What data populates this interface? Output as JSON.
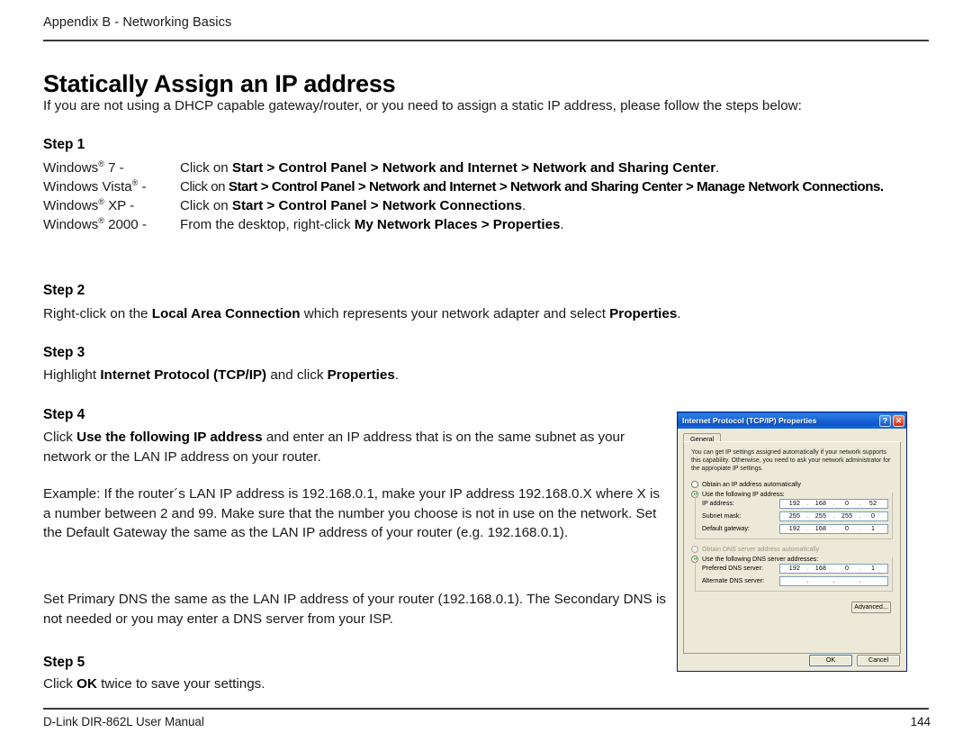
{
  "running_head": "Appendix B - Networking Basics",
  "page_title": "Statically Assign an IP address",
  "intro": "If you are not using a DHCP capable gateway/router, or you need to assign a static IP address, please follow the steps below:",
  "steps": {
    "step1": {
      "label": "Step 1",
      "rows": [
        {
          "os_prefix": "Windows",
          "os_reg": "®",
          "os_suffix": " 7 -",
          "instruction_lead": "Click on ",
          "instruction_bold1": "Start",
          "sep1": " > ",
          "instruction_bold2": "Control Panel",
          "sep2": " > ",
          "instruction_bold3": "Network and Internet",
          "sep3": " > ",
          "instruction_bold4": "Network and Sharing Center",
          "tail": "."
        },
        {
          "os_prefix": "Windows Vista",
          "os_reg": "®",
          "os_suffix": " -",
          "instruction_lead": "Click on ",
          "instruction_bold1": "Start",
          "sep1": " > ",
          "instruction_bold2": "Control Panel",
          "sep2": " > ",
          "instruction_bold3": "Network and Internet",
          "sep3": " > ",
          "instruction_bold4": "Network and Sharing Center",
          "sep4": " > ",
          "instruction_bold5": "Manage Network Connections",
          "tail": "."
        },
        {
          "os_prefix": "Windows",
          "os_reg": "®",
          "os_suffix": " XP -",
          "instruction_lead": "Click on ",
          "instruction_bold1": "Start",
          "sep1": " > ",
          "instruction_bold2": "Control Panel",
          "sep2": " > ",
          "instruction_bold3": "Network Connections",
          "tail": "."
        },
        {
          "os_prefix": "Windows",
          "os_reg": "®",
          "os_suffix": " 2000 -",
          "instruction_lead": "From the desktop, right-click ",
          "instruction_bold1": "My Network Places",
          "sep1": " > ",
          "instruction_bold2": "Properties",
          "tail": "."
        }
      ]
    },
    "step2": {
      "label": "Step 2",
      "text_a": "Right-click on the ",
      "bold_a": "Local Area Connection",
      "text_b": " which represents your network adapter and select ",
      "bold_b": "Properties",
      "text_c": "."
    },
    "step3": {
      "label": "Step 3",
      "text_a": "Highlight ",
      "bold_a": "Internet Protocol (TCP/IP)",
      "text_b": " and click ",
      "bold_b": "Properties",
      "text_c": "."
    },
    "step4": {
      "label": "Step 4",
      "text_a": "Click ",
      "bold_a": "Use the following IP address",
      "text_b": " and enter an IP address that is on the same subnet as your network or the LAN IP address on your router.",
      "example": "Example: If the router´s LAN IP address is 192.168.0.1, make your IP address 192.168.0.X where X is a number between 2 and 99. Make sure that the number you choose is not in use on the network. Set the Default Gateway the same as the LAN IP address of your router (e.g. 192.168.0.1).",
      "dns_note": "Set Primary DNS the same as the LAN IP address of your router (192.168.0.1). The Secondary DNS is not needed or you may enter a DNS server from your ISP."
    },
    "step5": {
      "label": "Step 5",
      "text_a": "Click ",
      "bold_a": "OK",
      "text_b": " twice to save your settings."
    }
  },
  "dialog": {
    "title": "Internet Protocol (TCP/IP) Properties",
    "help_button": "?",
    "close_button": "✕",
    "tab": "General",
    "description": "You can get IP settings assigned automatically if your network supports this capability. Otherwise, you need to ask your network administrator for the appropiate IP settings.",
    "radio_obtain_ip": "Obtain an IP address automatically",
    "radio_use_ip": "Use the following IP address:",
    "ip_label": "IP address:",
    "ip_value": [
      "192",
      "168",
      "0",
      "52"
    ],
    "subnet_label": "Subnet mask:",
    "subnet_value": [
      "255",
      "255",
      "255",
      "0"
    ],
    "gateway_label": "Default gateway:",
    "gateway_value": [
      "192",
      "168",
      "0",
      "1"
    ],
    "radio_obtain_dns": "Obtain DNS server address automatically",
    "radio_use_dns": "Use the following DNS server addresses:",
    "preferred_dns_label": "Prefered DNS server:",
    "preferred_dns_value": [
      "192",
      "168",
      "0",
      "1"
    ],
    "alternate_dns_label": "Alternate DNS server:",
    "alternate_dns_value": [
      "",
      "",
      "",
      ""
    ],
    "advanced_button": "Advanced...",
    "ok_button": "OK",
    "cancel_button": "Cancel",
    "colors": {
      "titlebar": "#1b65d6",
      "face": "#ece9d8",
      "close": "#cf2d14",
      "radio_dot": "#1a8a1a",
      "field_border": "#7f9db9"
    }
  },
  "footer": {
    "left": "D-Link DIR-862L User Manual",
    "page_number": "144"
  }
}
